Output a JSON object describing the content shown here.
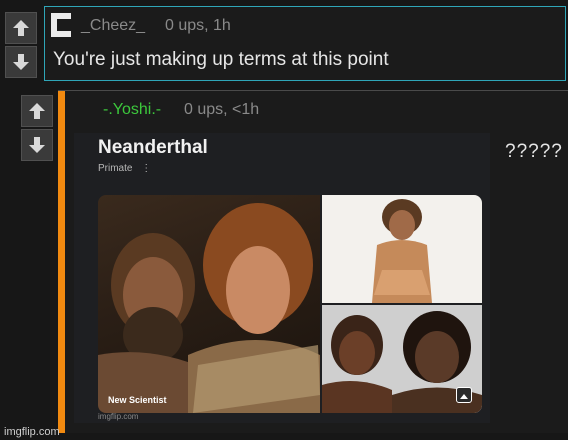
{
  "comment1": {
    "username": "_Cheez_",
    "meta": "0 ups, 1h",
    "text": "You're just making up terms at this point"
  },
  "comment2": {
    "username": "-.Yoshi.-",
    "meta": "0 ups, <1h",
    "text": "?????",
    "image": {
      "title": "Neanderthal",
      "subtitle": "Primate",
      "subtitle_icon": "⋮",
      "credit": "New Scientist",
      "watermark": "imgflip.com"
    }
  },
  "watermark": "imgflip.com",
  "colors": {
    "accent_border": "#2fa6b8",
    "op_stripe": "#f28a10",
    "username_op": "#3cc73c"
  },
  "icons": [
    "upvote-arrow-icon",
    "downvote-arrow-icon",
    "avatar-icon",
    "image-icon"
  ]
}
